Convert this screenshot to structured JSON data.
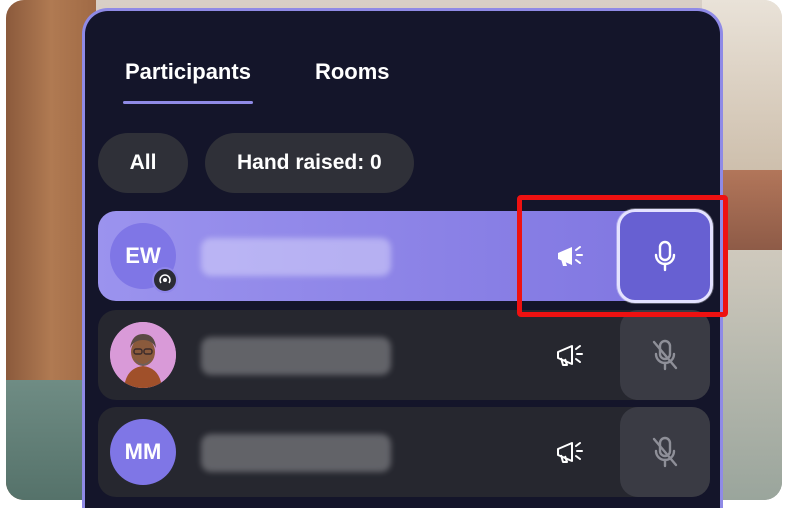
{
  "tabs": [
    {
      "label": "Participants",
      "active": true
    },
    {
      "label": "Rooms",
      "active": false
    }
  ],
  "filters": {
    "all_label": "All",
    "hand_raised_label": "Hand raised: 0"
  },
  "participants": [
    {
      "initials": "EW",
      "avatar_type": "initials",
      "avatar_color": "#7f76e6",
      "badge_icon": "presence-icon",
      "mic_state": "on",
      "highlighted": true
    },
    {
      "initials": "",
      "avatar_type": "photo",
      "mic_state": "muted"
    },
    {
      "initials": "MM",
      "avatar_type": "initials",
      "avatar_color": "#7f76e6",
      "mic_state": "muted"
    }
  ],
  "colors": {
    "panel_bg": "#14152a",
    "accent": "#8f8ae6",
    "active_row": "#8a81ea",
    "highlight_box": "#ee1111"
  },
  "icons": {
    "announce": "megaphone-icon",
    "mic_on": "microphone-icon",
    "mic_off": "microphone-muted-icon"
  }
}
